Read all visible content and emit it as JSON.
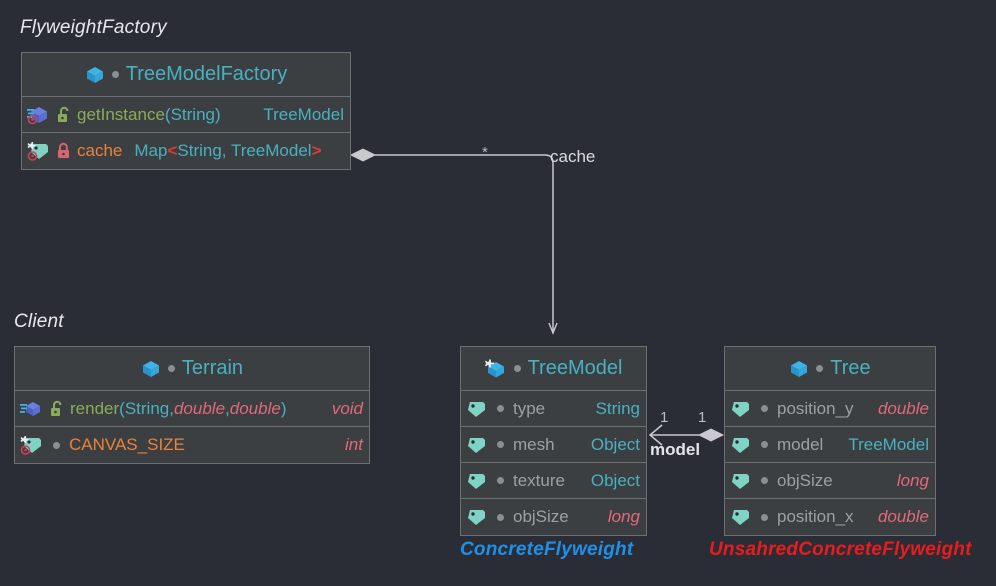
{
  "diagram": {
    "title": "Flyweight pattern UML class diagram",
    "background": "#2b2d36",
    "box_fill": "#3c3f41",
    "box_border": "#6e7174"
  },
  "captions": {
    "flyweight_factory": "FlyweightFactory",
    "client": "Client",
    "concrete_flyweight": "ConcreteFlyweight",
    "unshared_concrete_flyweight": "UnsahredConcreteFlyweight"
  },
  "classes": {
    "tree_model_factory": {
      "name": "TreeModelFactory",
      "icon": "class-icon",
      "visibility_icon": "package-dot-icon",
      "members": [
        {
          "icon": "static-method-icon",
          "access_icon": "unlock-icon",
          "name": "getInstance",
          "name_style": "method",
          "params_open": "(",
          "params": "String",
          "params_close": ")",
          "type": "TreeModel",
          "type_style": "type"
        },
        {
          "icon": "static-final-field-icon",
          "access_icon": "lock-icon",
          "name": "cache",
          "name_style": "static",
          "type_prefix": "Map",
          "angle_open": "<",
          "generic_args": "String, TreeModel",
          "angle_close": ">"
        }
      ]
    },
    "terrain": {
      "name": "Terrain",
      "icon": "class-icon",
      "visibility_icon": "package-dot-icon",
      "members": [
        {
          "icon": "static-method-icon",
          "access_icon": "unlock-icon",
          "name": "render",
          "name_style": "method",
          "params_open": "(",
          "param1": "String",
          "comma1": ", ",
          "param2": "double",
          "comma2": ", ",
          "param3": "double",
          "params_close": ")",
          "type": "void",
          "type_style": "prim"
        },
        {
          "icon": "static-final-field-icon",
          "access_icon": "package-dot-icon",
          "name": "CANVAS_SIZE",
          "name_style": "static",
          "type": "int",
          "type_style": "prim"
        }
      ]
    },
    "tree_model": {
      "name": "TreeModel",
      "icon": "final-class-icon",
      "visibility_icon": "package-dot-icon",
      "members": [
        {
          "icon": "field-icon",
          "access_icon": "package-dot-icon",
          "name": "type",
          "type": "String",
          "type_style": "type"
        },
        {
          "icon": "field-icon",
          "access_icon": "package-dot-icon",
          "name": "mesh",
          "type": "Object",
          "type_style": "type"
        },
        {
          "icon": "field-icon",
          "access_icon": "package-dot-icon",
          "name": "texture",
          "type": "Object",
          "type_style": "type"
        },
        {
          "icon": "field-icon",
          "access_icon": "package-dot-icon",
          "name": "objSize",
          "type": "long",
          "type_style": "prim"
        }
      ]
    },
    "tree": {
      "name": "Tree",
      "icon": "class-icon",
      "visibility_icon": "package-dot-icon",
      "members": [
        {
          "icon": "field-icon",
          "access_icon": "package-dot-icon",
          "name": "position_y",
          "type": "double",
          "type_style": "prim"
        },
        {
          "icon": "field-icon",
          "access_icon": "package-dot-icon",
          "name": "model",
          "type": "TreeModel",
          "type_style": "type"
        },
        {
          "icon": "field-icon",
          "access_icon": "package-dot-icon",
          "name": "objSize",
          "type": "long",
          "type_style": "prim"
        },
        {
          "icon": "field-icon",
          "access_icon": "package-dot-icon",
          "name": "position_x",
          "type": "double",
          "type_style": "prim"
        }
      ]
    }
  },
  "associations": {
    "cache_edge": {
      "source": "TreeModelFactory",
      "target": "TreeModel",
      "source_multiplicity": "*",
      "target_label": "cache",
      "kind": "aggregation-arrow"
    },
    "model_edge": {
      "source": "Tree",
      "target": "TreeModel",
      "source_multiplicity": "1",
      "target_multiplicity": "1",
      "role_label": "model",
      "kind": "aggregation-arrow"
    }
  }
}
